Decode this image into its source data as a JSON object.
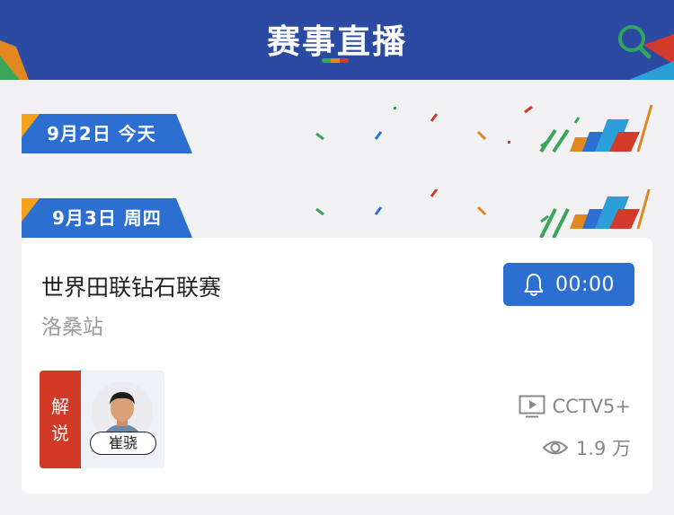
{
  "header": {
    "title": "赛事直播",
    "search_icon": "search-icon"
  },
  "dates": [
    {
      "label": "9月2日 今天"
    },
    {
      "label": "9月3日 周四"
    }
  ],
  "event": {
    "title": "世界田联钻石联赛",
    "subtitle": "洛桑站",
    "remind": {
      "icon": "bell-icon",
      "time": "00:00"
    },
    "commentary": {
      "badge_line1": "解",
      "badge_line2": "说",
      "commentator": "崔骁"
    },
    "channel": {
      "icon": "tv-icon",
      "name": "CCTV5+"
    },
    "views": {
      "icon": "eye-icon",
      "count": "1.9 万"
    }
  },
  "colors": {
    "header_bg": "#2b4aa2",
    "tag_blue": "#2c6fd0",
    "accent_orange": "#f5a01b",
    "button_blue": "#2c6fd0",
    "badge_red": "#d13a26",
    "search_green": "#2fa55f"
  }
}
